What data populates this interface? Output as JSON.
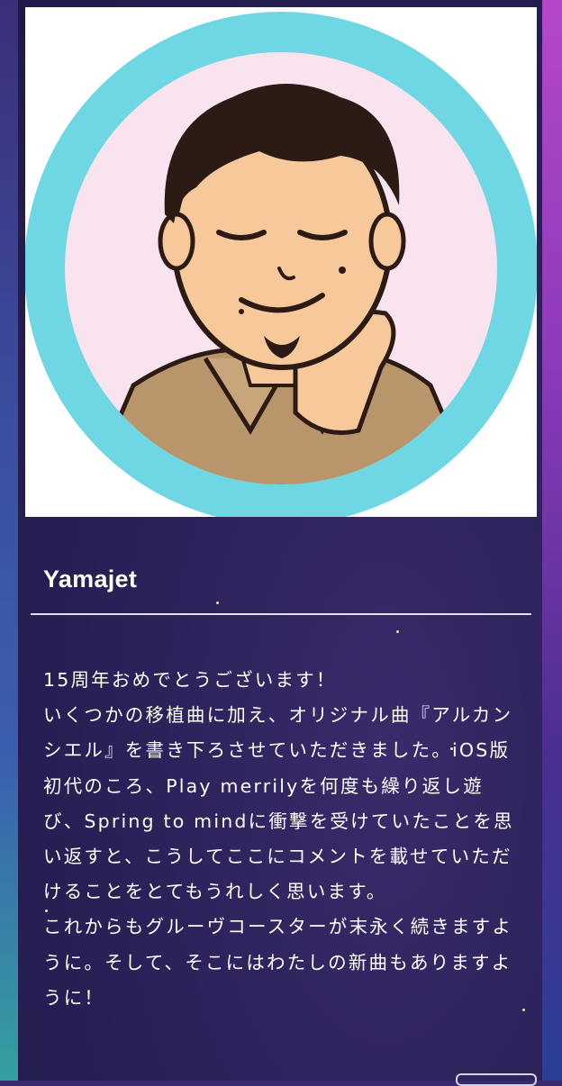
{
  "profile": {
    "name": "Yamajet",
    "avatar_icon": "illustrated-portrait-avatar"
  },
  "comment": {
    "paragraphs": [
      "15周年おめでとうございます！",
      "いくつかの移植曲に加え、オリジナル曲『アルカンシエル』を書き下ろさせていただきました。iOS版初代のころ、Play merrilyを何度も繰り返し遊び、Spring to mindに衝撃を受けていたことを思い返すと、こうしてここにコメントを載せていただけることをとてもうれしく思います。",
      "これからもグルーヴコースターが末永く続きますように。そして、そこにはわたしの新曲もありますように！"
    ]
  },
  "colors": {
    "avatar_ring": "#6fd6e3",
    "avatar_bg": "#f9e3ee",
    "text": "#ffffff",
    "divider": "#e6e2ef"
  }
}
